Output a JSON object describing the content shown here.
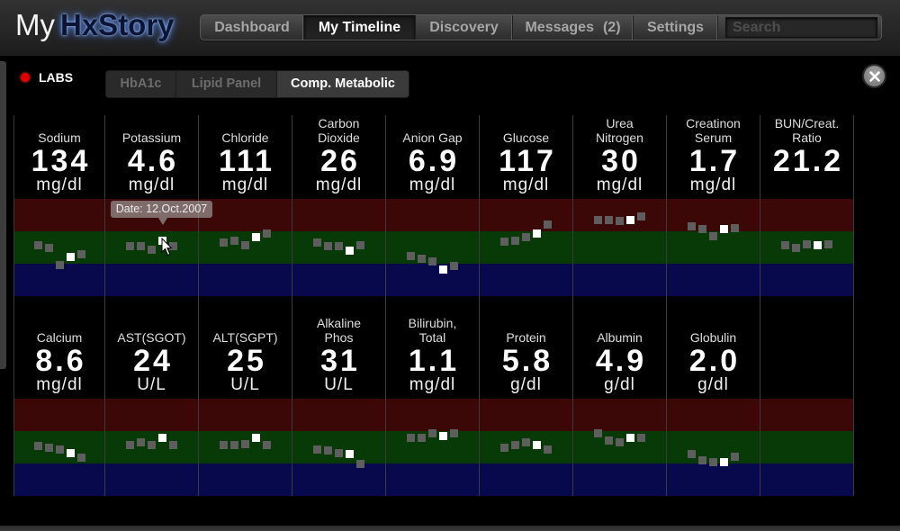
{
  "app": {
    "logo_my": "My",
    "logo_brand": "HxStory"
  },
  "nav": {
    "items": [
      {
        "label": "Dashboard"
      },
      {
        "label": "My Timeline",
        "active": true
      },
      {
        "label": "Discovery"
      },
      {
        "label": "Messages",
        "badge": "(2)"
      },
      {
        "label": "Settings"
      }
    ],
    "search_placeholder": "Search"
  },
  "labs": {
    "title": "LABS",
    "tabs": [
      {
        "label": "HbA1c"
      },
      {
        "label": "Lipid Panel"
      },
      {
        "label": "Comp. Metabolic",
        "active": true
      }
    ],
    "tooltip": "Date: 12.Oct.2007",
    "selected_point_index": 3,
    "rows": [
      {
        "cells": [
          {
            "label_lines": [
              "Sodium"
            ],
            "value": "134",
            "unit": "mg/dl",
            "trend": [
              1.58,
              1.5,
              0.97,
              1.22,
              1.28
            ]
          },
          {
            "label_lines": [
              "Potassium"
            ],
            "value": "4.6",
            "unit": "mg/dl",
            "trend": [
              1.53,
              1.53,
              1.44,
              1.72,
              1.53
            ]
          },
          {
            "label_lines": [
              "Chloride"
            ],
            "value": "111",
            "unit": "mg/dl",
            "trend": [
              1.64,
              1.72,
              1.58,
              1.81,
              1.94
            ]
          },
          {
            "label_lines": [
              "Carbon",
              "Dioxide"
            ],
            "value": "26",
            "unit": "mg/dl",
            "trend": [
              1.64,
              1.53,
              1.53,
              1.39,
              1.58
            ]
          },
          {
            "label_lines": [
              "Anion Gap"
            ],
            "value": "6.9",
            "unit": "mg/dl",
            "trend": [
              1.25,
              1.14,
              1.08,
              0.83,
              0.92
            ]
          },
          {
            "label_lines": [
              "Glucose"
            ],
            "value": "117",
            "unit": "mg/dl",
            "trend": [
              1.69,
              1.72,
              1.81,
              1.94,
              2.22
            ]
          },
          {
            "label_lines": [
              "Urea",
              "Nitrogen"
            ],
            "value": "30",
            "unit": "mg/dl",
            "trend": [
              2.36,
              2.36,
              2.31,
              2.36,
              2.47
            ]
          },
          {
            "label_lines": [
              "Creatinon",
              "Serum"
            ],
            "value": "1.7",
            "unit": "mg/dl",
            "trend": [
              2.14,
              2.06,
              1.86,
              2.06,
              2.11
            ]
          },
          {
            "label_lines": [
              "BUN/Creat.",
              "Ratio"
            ],
            "value": "21.2",
            "trend": [
              1.58,
              1.5,
              1.61,
              1.56,
              1.61
            ]
          }
        ]
      },
      {
        "cells": [
          {
            "label_lines": [
              "Calcium"
            ],
            "value": "8.6",
            "unit": "mg/dl",
            "trend": [
              1.53,
              1.5,
              1.44,
              1.33,
              1.19
            ]
          },
          {
            "label_lines": [
              "AST(SGOT)"
            ],
            "value": "24",
            "unit": "U/L",
            "trend": [
              1.58,
              1.64,
              1.58,
              1.78,
              1.58
            ]
          },
          {
            "label_lines": [
              "ALT(SGPT)"
            ],
            "value": "25",
            "unit": "U/L",
            "trend": [
              1.58,
              1.56,
              1.61,
              1.78,
              1.58
            ]
          },
          {
            "label_lines": [
              "Alkaline",
              "Phos"
            ],
            "value": "31",
            "unit": "U/L",
            "trend": [
              1.44,
              1.39,
              1.33,
              1.28,
              1.0
            ]
          },
          {
            "label_lines": [
              "Bilirubin,",
              "Total"
            ],
            "value": "1.1",
            "unit": "mg/dl",
            "trend": [
              1.78,
              1.78,
              1.92,
              1.86,
              1.92
            ]
          },
          {
            "label_lines": [
              "Protein"
            ],
            "value": "5.8",
            "unit": "g/dl",
            "trend": [
              1.5,
              1.58,
              1.64,
              1.58,
              1.44
            ]
          },
          {
            "label_lines": [
              "Albumin"
            ],
            "value": "4.9",
            "unit": "g/dl",
            "trend": [
              1.92,
              1.72,
              1.64,
              1.78,
              1.78
            ]
          },
          {
            "label_lines": [
              "Globulin"
            ],
            "value": "2.0",
            "unit": "g/dl",
            "trend": [
              1.28,
              1.11,
              1.03,
              1.03,
              1.22
            ]
          },
          {}
        ]
      }
    ]
  },
  "colors": {
    "high_band": "#3b0707",
    "normal_band": "#073a07",
    "low_band": "#08084c",
    "point": "#5e5e5e",
    "point_selected": "#ffffff",
    "labs_indicator": "#e00000"
  },
  "icons": {
    "close": "close-icon",
    "cursor": "mouse-cursor-icon",
    "labs_status": "red-dot-icon"
  }
}
